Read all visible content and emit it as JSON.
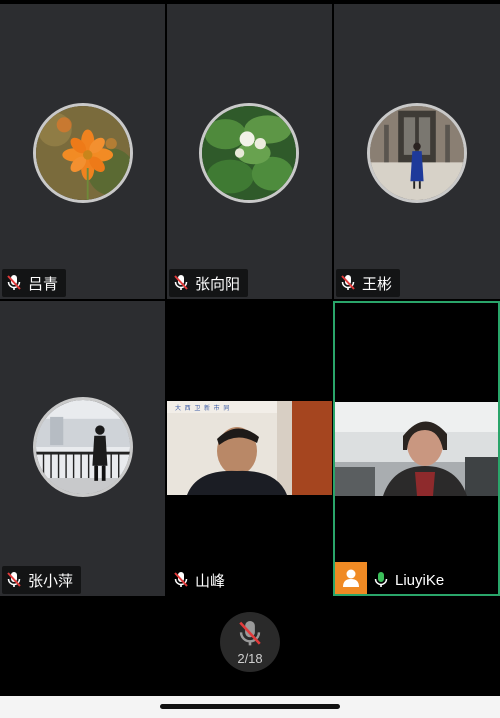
{
  "participants": [
    {
      "name": "吕青",
      "muted": true
    },
    {
      "name": "张向阳",
      "muted": true
    },
    {
      "name": "王彬",
      "muted": true
    },
    {
      "name": "张小萍",
      "muted": true
    },
    {
      "name": "山峰",
      "muted": true
    },
    {
      "name": "LiuyiKe",
      "muted": false,
      "speaking": true
    }
  ],
  "video_caption": "大 西 卫 新 市 同",
  "bottom": {
    "page_indicator": "2/18",
    "mic_state": "muted"
  },
  "colors": {
    "tile_bg": "#2c2d30",
    "active_border": "#2aa56a",
    "muted_mic": "#e23b3b",
    "mic_on": "#3bbf5a",
    "user_badge": "#f08a24"
  },
  "icons": [
    "microphone-muted-icon",
    "microphone-icon",
    "user-icon"
  ]
}
